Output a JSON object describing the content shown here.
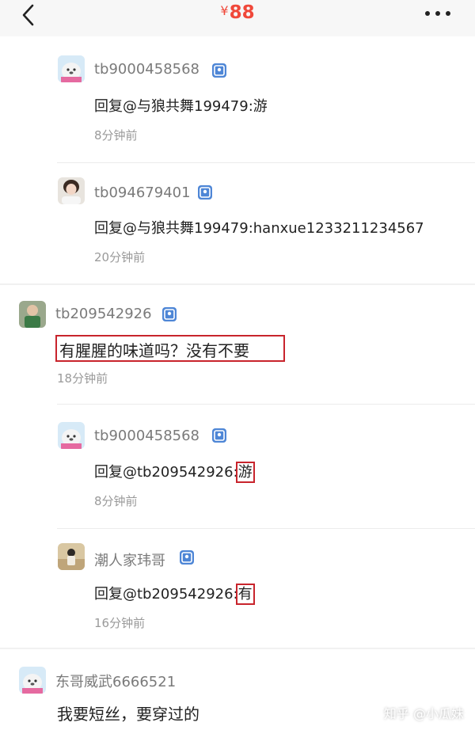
{
  "header": {
    "currency": "¥",
    "price": "88",
    "colors": {
      "price": "#f0483a",
      "background": "#f7f7f7"
    }
  },
  "comments": [
    {
      "username": "tb9000458568",
      "text": "回复@与狼共舞199479:游",
      "time": "8分钟前"
    },
    {
      "username": "tb094679401",
      "text": "回复@与狼共舞199479:hanxue1233211234567",
      "time": "20分钟前"
    },
    {
      "username": "tb209542926",
      "text": "有腥腥的味道吗？没有不要",
      "time": "18分钟前"
    },
    {
      "username": "tb9000458568",
      "text_prefix": "回复@tb209542926:",
      "text_highlight": "游",
      "time": "8分钟前"
    },
    {
      "username": "潮人家玮哥",
      "text_prefix": "回复@tb209542926:",
      "text_highlight": "有",
      "time": "16分钟前"
    },
    {
      "username": "东哥威武6666521",
      "text": "我要短丝，要穿过的"
    }
  ],
  "watermark": "知乎 @小瓜妹",
  "highlight_color": "#c8242c"
}
